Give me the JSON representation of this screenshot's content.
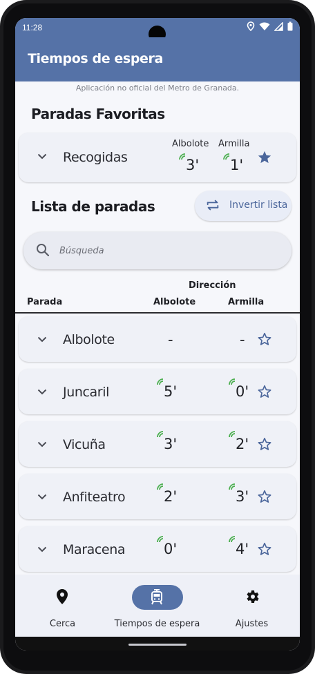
{
  "status": {
    "time": "11:28"
  },
  "app": {
    "title": "Tiempos de espera",
    "disclaimer": "Aplicación no oficial del Metro de Granada."
  },
  "favorites": {
    "title": "Paradas Favoritas",
    "dir1": "Albolote",
    "dir2": "Armilla",
    "items": [
      {
        "name": "Recogidas",
        "t1": "3'",
        "t2": "1'",
        "favorite": true
      }
    ]
  },
  "list": {
    "title": "Lista de paradas",
    "invert_label": "Invertir lista",
    "search_placeholder": "Búsqueda",
    "header": {
      "direction": "Dirección",
      "stop": "Parada",
      "dir1": "Albolote",
      "dir2": "Armilla"
    },
    "stops": [
      {
        "name": "Albolote",
        "t1": "-",
        "t2": "-",
        "live": false
      },
      {
        "name": "Juncaril",
        "t1": "5'",
        "t2": "0'",
        "live": true
      },
      {
        "name": "Vicuña",
        "t1": "3'",
        "t2": "2'",
        "live": true
      },
      {
        "name": "Anfiteatro",
        "t1": "2'",
        "t2": "3'",
        "live": true
      },
      {
        "name": "Maracena",
        "t1": "0'",
        "t2": "4'",
        "live": true
      }
    ]
  },
  "nav": {
    "items": [
      {
        "label": "Cerca",
        "icon": "location-pin-icon",
        "active": false
      },
      {
        "label": "Tiempos de espera",
        "icon": "tram-icon",
        "active": true
      },
      {
        "label": "Ajustes",
        "icon": "gear-icon",
        "active": false
      }
    ]
  },
  "colors": {
    "primary": "#5572a7",
    "signal": "#4caf50",
    "card": "#eff1f7",
    "background": "#f6f7fb"
  }
}
